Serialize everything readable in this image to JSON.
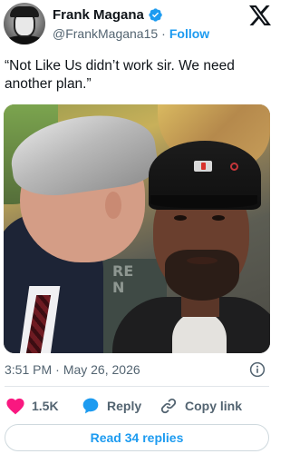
{
  "author": {
    "display_name": "Frank Magana",
    "handle": "@FrankMagana15",
    "verified": true,
    "follow_label": "Follow",
    "separator": "·"
  },
  "tweet": {
    "text": "“Not Like Us didn’t work sir. We need another plan.”",
    "media_overlay_text": "RE\nN"
  },
  "meta": {
    "time": "3:51 PM",
    "separator": "·",
    "date": "May 26, 2026"
  },
  "actions": {
    "like_count": "1.5K",
    "reply_label": "Reply",
    "copy_link_label": "Copy link"
  },
  "read_replies_label": "Read 34 replies",
  "colors": {
    "accent": "#1d9bf0",
    "like": "#f91880",
    "text_primary": "#0f1419",
    "text_secondary": "#536471"
  },
  "icons": {
    "logo": "x-logo-icon",
    "verified": "verified-badge-icon",
    "info": "info-icon",
    "like": "heart-icon",
    "reply": "reply-bubble-icon",
    "copy": "link-icon"
  }
}
